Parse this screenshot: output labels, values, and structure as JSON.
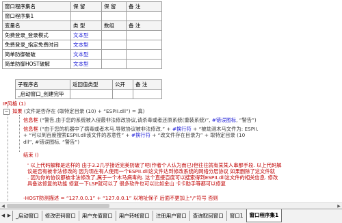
{
  "program_table": {
    "row1": [
      "窗口程序集名",
      "保 留",
      "保 留",
      "备 注"
    ],
    "row2": [
      "窗口程序集1",
      "",
      "",
      ""
    ],
    "header": [
      "变量名",
      "类 型",
      "数组",
      "备 注"
    ],
    "vars": [
      {
        "name": "免费登录_登录模式",
        "type": "文本型"
      },
      {
        "name": "免费登录_指定免费时间",
        "type": "文本型"
      },
      {
        "name": "简单防御破破",
        "type": "文本型"
      },
      {
        "name": "简单防御HOST破解",
        "type": "文本型"
      }
    ]
  },
  "sub_table": {
    "header": [
      "子程序名",
      "返回值类型",
      "公开",
      "备 注"
    ],
    "row": [
      "_启动窗口_创建完毕",
      "",
      "",
      ""
    ]
  },
  "code": {
    "line1": "IP风格 (1)",
    "line2": {
      "kw": "如果",
      "cond": " (文件是否存在 (取特定目录 (10) + ",
      "str": "“ESPII.dll”",
      "end": ") = 真)"
    },
    "line3": {
      "kw": "信息框",
      "a": " (“警告,由于您的系统被入侵最非法修改协议,请杀毒或者还原系统(重装系统)”, ",
      "b": "#错误图标",
      "c": ", “警告”)"
    },
    "line4": {
      "kw": "信息框",
      "a": " (“由于您的机器中了病毒或者木马.导致协议被非法修改.” + ",
      "b": "#换行符",
      "c": " + “被劫测木马文件为: ESPII.",
      "d": " + “可以到百度搜索ESPII.dll该文件的恶意性” + ",
      "e": "#换行符",
      "f": " + “改文件存在目录为” + ",
      "g": "取特定目录 (10",
      "h": "dll”, #错误图标, “警告”)"
    },
    "line5": "结束 ()",
    "comment1": "' 以上代码解释是这样的 由于3.2几乎接近完美防破了吧(作者个人认为而已)但往往就有某某人串那手段. 以上代码解",
    "comment2": "议是否有被非法修改的 因为现在有人使用一个ESPII.dll这文件达到修改系统的网络分层协议 如果删除了这文件就",
    "comment3": ". 因为你的协议都被非法修改了,属于一个木马病毒的. 这个直接百度可以搜索得到ESPII.dll这文件的相关信息. 修改",
    "comment4": "具备这修复的功能 修复一下LSP就可以了 很多软件也可以比如金山 卡卡助手等都可以修复",
    "partial": "-HOST防测描述 = “127.0.0.1” + “127.0.0.1” 以地址保子 后面不更加上“/”符号 否则"
  },
  "tabs": [
    "_启动窗口",
    "修改密码窗口",
    "用户充值窗口",
    "用户转帐窗口",
    "注册用户窗口",
    "查询取回窗口",
    "窗口1",
    "窗口程序集1"
  ],
  "active_tab": "窗口程序集1",
  "colors": {
    "keyword": "#c00000",
    "type": "#1b1bd6",
    "comment": "#3c8d3c"
  }
}
